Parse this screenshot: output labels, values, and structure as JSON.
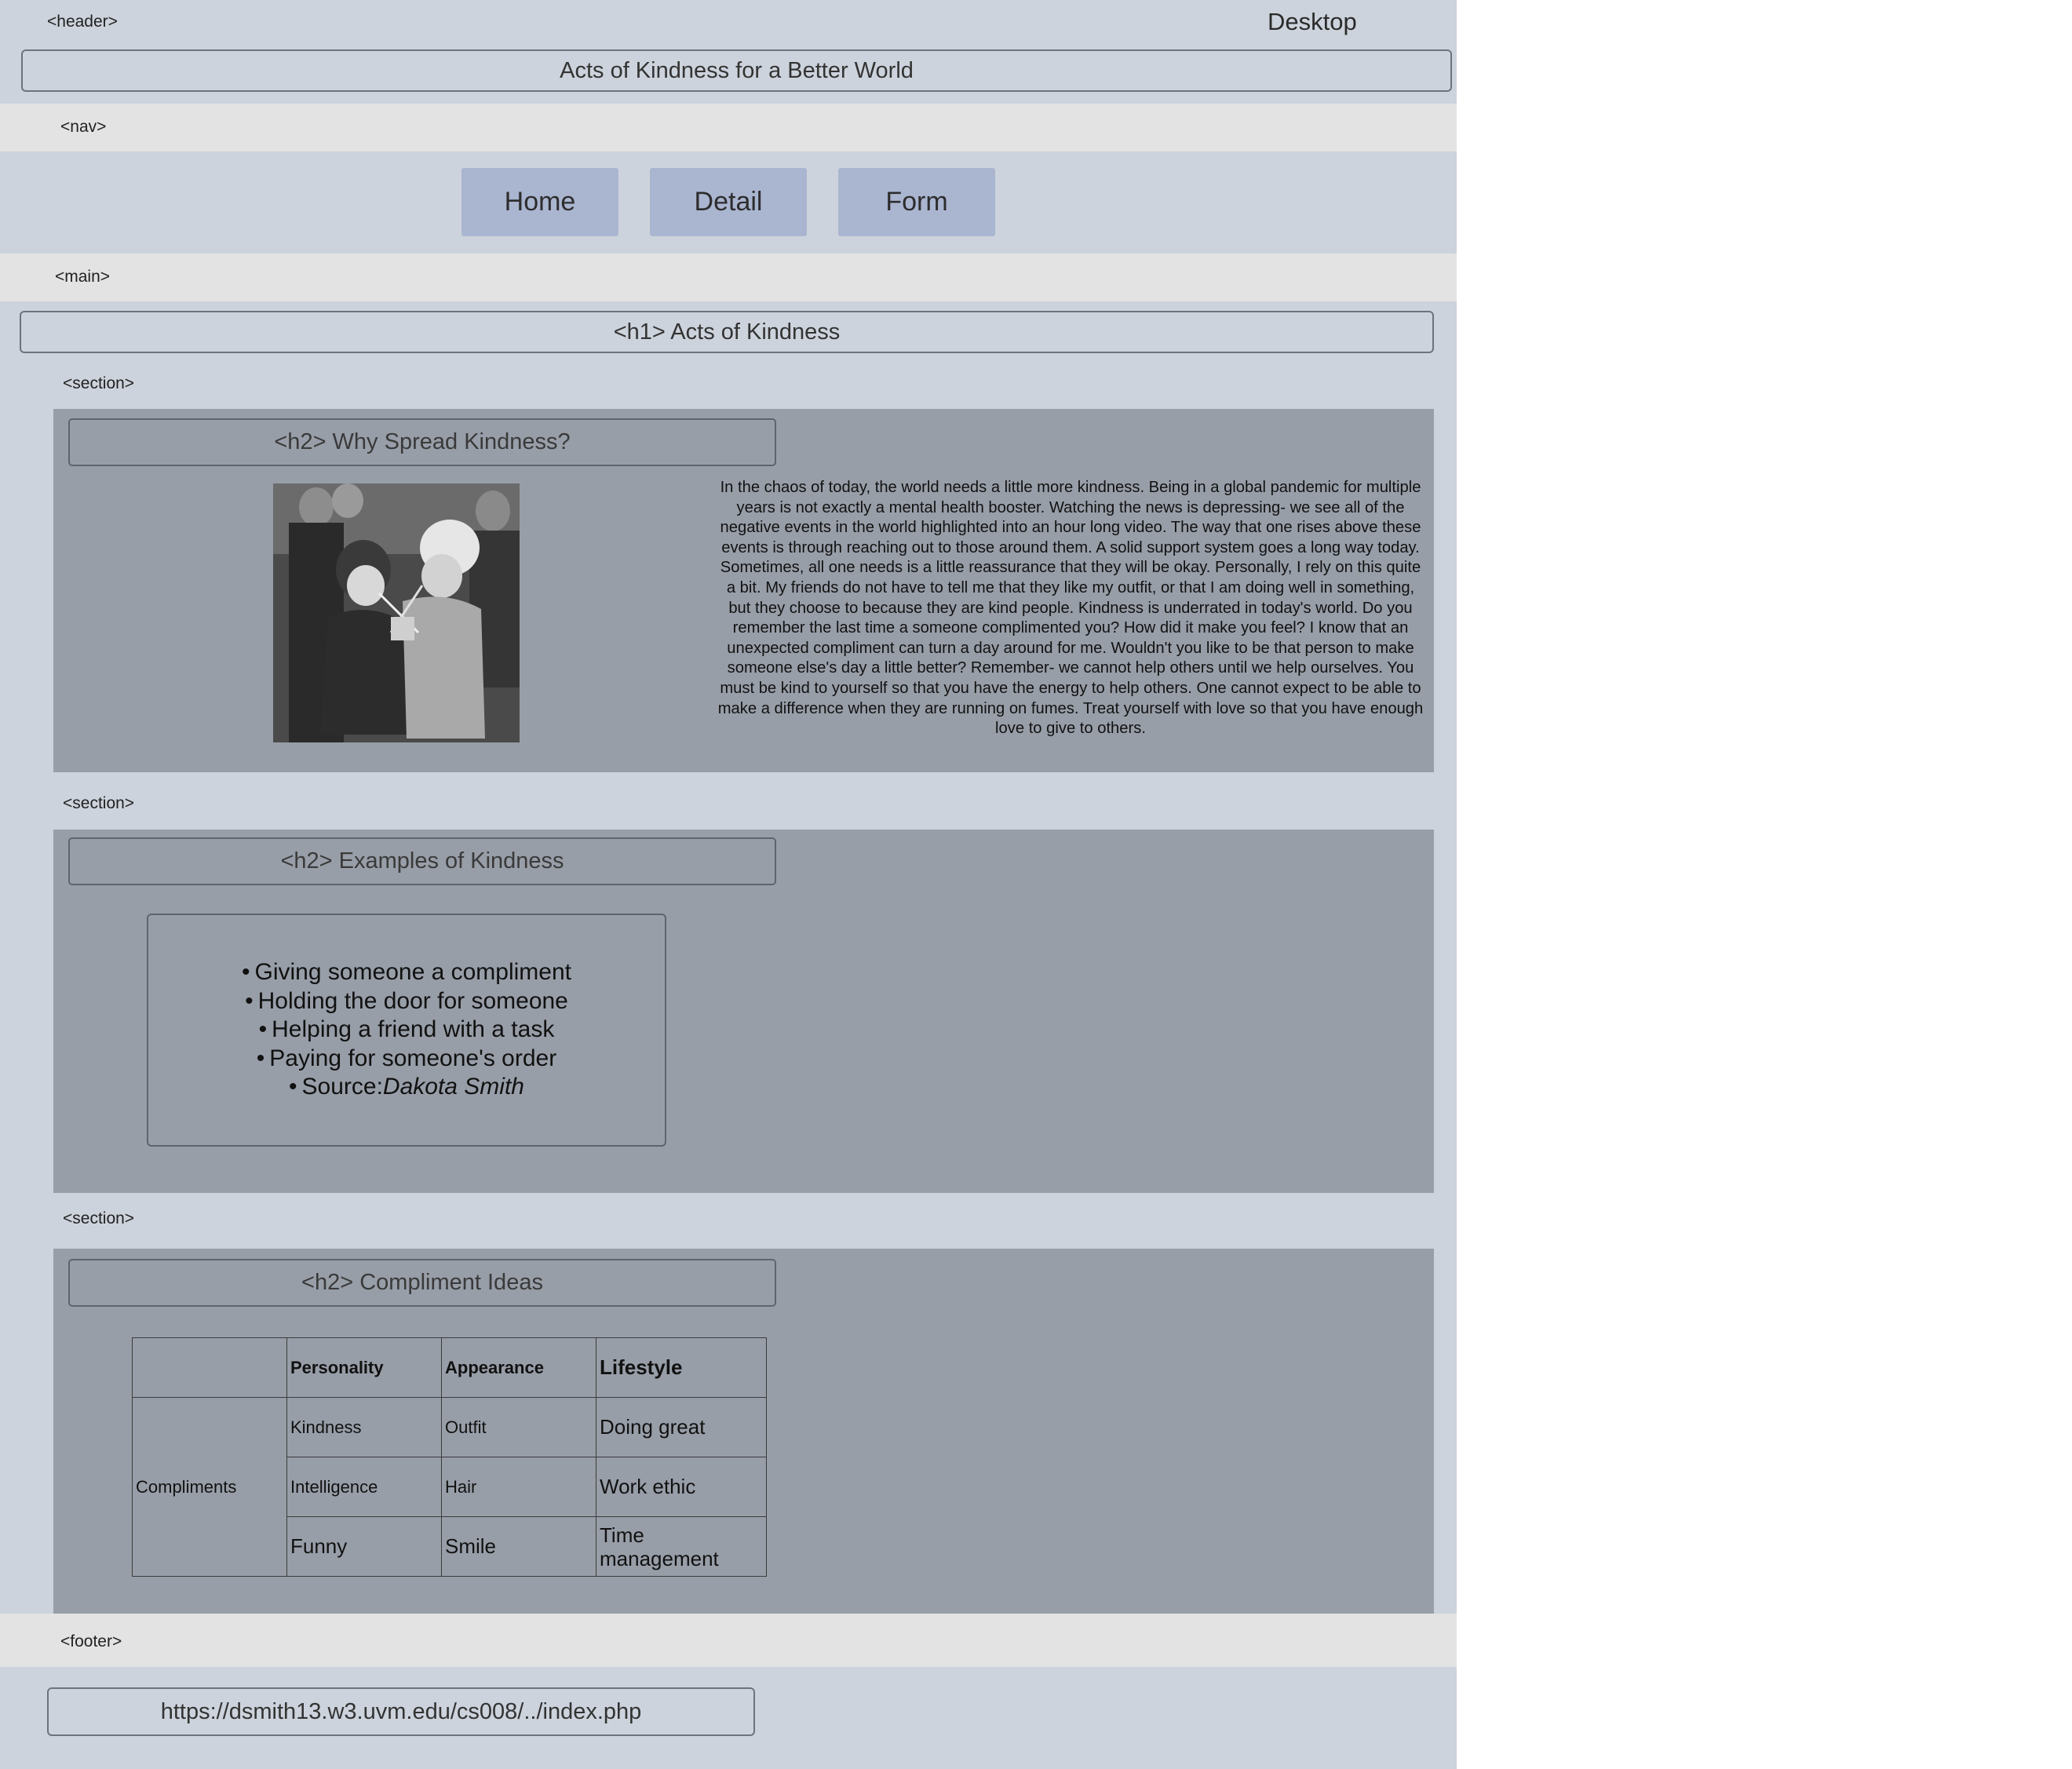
{
  "header": {
    "tag": "<header>",
    "device_label": "Desktop",
    "site_title": "Acts of Kindness for a Better World"
  },
  "nav": {
    "tag": "<nav>",
    "items": [
      "Home",
      "Detail",
      "Form"
    ]
  },
  "main": {
    "tag": "<main>",
    "h1": "<h1> Acts of Kindness",
    "sections": [
      {
        "tag": "<section>",
        "h2": "<h2> Why Spread Kindness?",
        "paragraph": "In the chaos of today, the world needs a little more kindness. Being in a global pandemic for multiple years is not exactly a mental health booster. Watching the news is depressing- we see all of the negative events in the world highlighted into an hour long video. The way that one rises above these events is through reaching out to those around them. A solid support system goes a long way today. Sometimes, all one needs is a little reassurance that they will be okay. Personally, I rely on this quite a bit. My friends do not have to tell me that they like my outfit, or that I am doing well in something, but they choose to because they are kind people. Kindness is underrated in today's world. Do you remember the last time a someone complimented you? How did it make you feel? I know that an unexpected compliment can turn a day around for me. Wouldn't you like to be that person to make someone else's day a little better? Remember- we cannot help others until we help ourselves. You must be kind to yourself so that you have the energy to help others. One cannot expect to be able to make a difference when they are running on fumes. Treat yourself with love so that you have enough love to give to others."
      },
      {
        "tag": "<section>",
        "h2": "<h2> Examples of Kindness",
        "list": [
          "Giving someone a compliment",
          "Holding the door for someone",
          "Helping a friend with a task",
          "Paying for someone's order"
        ],
        "source_prefix": "Source:",
        "source_name": "Dakota Smith"
      },
      {
        "tag": "<section>",
        "h2": "<h2> Compliment Ideas",
        "table": {
          "headers": [
            "",
            "Personality",
            "Appearance",
            "Lifestyle"
          ],
          "row_label": "Compliments",
          "rows": [
            [
              "Kindness",
              "Outfit",
              "Doing great"
            ],
            [
              "Intelligence",
              "Hair",
              "Work ethic"
            ],
            [
              "Funny",
              "Smile",
              "Time management"
            ]
          ]
        }
      }
    ]
  },
  "footer": {
    "tag": "<footer>",
    "url": "https://dsmith13.w3.uvm.edu/cs008/../index.php"
  },
  "colors": {
    "canvas": "#cdd3dc",
    "band": "#e3e3e3",
    "section": "#989ea8",
    "nav_button": "#aab5d0"
  }
}
